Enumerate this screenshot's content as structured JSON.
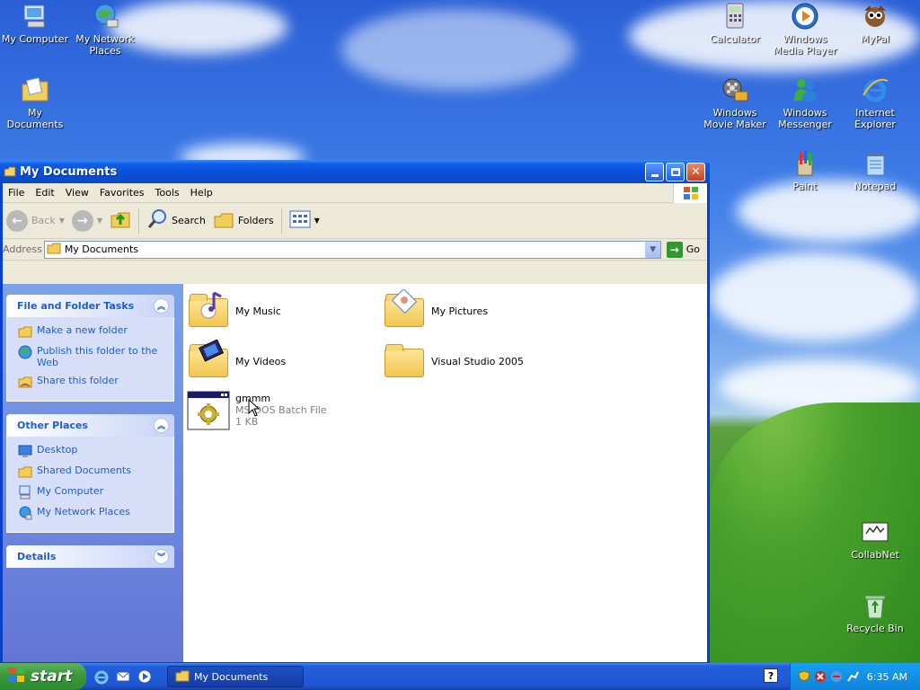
{
  "desktop": {
    "icons": [
      {
        "label": "My Computer"
      },
      {
        "label": "My Network Places"
      },
      {
        "label": "My Documents"
      },
      {
        "label": "Calculator"
      },
      {
        "label": "Windows Media Player"
      },
      {
        "label": "MyPal"
      },
      {
        "label": "Windows Movie Maker"
      },
      {
        "label": "Windows Messenger"
      },
      {
        "label": "Internet Explorer"
      },
      {
        "label": "Paint"
      },
      {
        "label": "Notepad"
      },
      {
        "label": "CollabNet"
      },
      {
        "label": "Recycle Bin"
      }
    ]
  },
  "window": {
    "title": "My Documents",
    "menu": [
      "File",
      "Edit",
      "View",
      "Favorites",
      "Tools",
      "Help"
    ],
    "toolbar": {
      "back": "Back",
      "search": "Search",
      "folders": "Folders"
    },
    "address": {
      "label": "Address",
      "value": "My Documents",
      "go": "Go"
    },
    "tasks": {
      "file_folder": {
        "title": "File and Folder Tasks",
        "items": [
          "Make a new folder",
          "Publish this folder to the Web",
          "Share this folder"
        ]
      },
      "other_places": {
        "title": "Other Places",
        "items": [
          "Desktop",
          "Shared Documents",
          "My Computer",
          "My Network Places"
        ]
      },
      "details": {
        "title": "Details"
      }
    },
    "files": [
      {
        "name": "My Music"
      },
      {
        "name": "My Pictures"
      },
      {
        "name": "My Videos"
      },
      {
        "name": "Visual Studio 2005"
      },
      {
        "name": "gmmm",
        "type": "MS-DOS Batch File",
        "size": "1 KB"
      }
    ]
  },
  "taskbar": {
    "start": "start",
    "task": "My Documents",
    "clock": "6:35 AM"
  },
  "colors": {
    "link": "#215dc6",
    "titlebar": "#0a4fd6",
    "start": "#3c9a3c"
  }
}
